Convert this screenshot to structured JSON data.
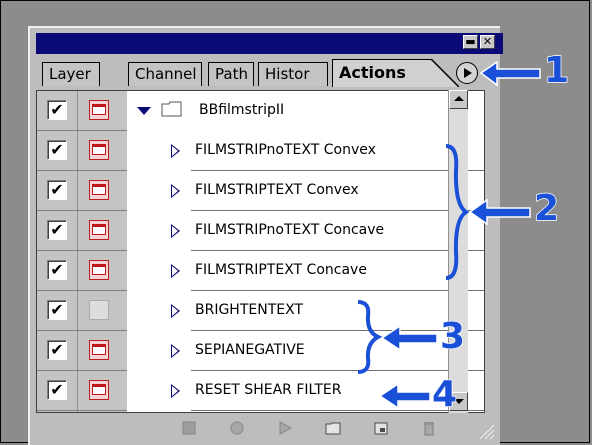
{
  "window": {
    "minimize_glyph": "▬",
    "close_glyph": "✕"
  },
  "tabs": [
    {
      "label": "Layer"
    },
    {
      "label": "Channel"
    },
    {
      "label": "Path"
    },
    {
      "label": "Histor"
    },
    {
      "label": "Actions",
      "active": true
    }
  ],
  "menu_button": {
    "icon": "play-circle-icon"
  },
  "action_set": {
    "name": "BBfilmstripII",
    "expanded": true,
    "icon": "folder-icon"
  },
  "actions": [
    {
      "label": "FILMSTRIPnoTEXT Convex",
      "checked": true,
      "dialog": true
    },
    {
      "label": "FILMSTRIPTEXT Convex",
      "checked": true,
      "dialog": true
    },
    {
      "label": "FILMSTRIPnoTEXT Concave",
      "checked": true,
      "dialog": true
    },
    {
      "label": "FILMSTRIPTEXT Concave",
      "checked": true,
      "dialog": true
    },
    {
      "label": "BRIGHTENTEXT",
      "checked": true,
      "dialog": false
    },
    {
      "label": "SEPIANEGATIVE",
      "checked": true,
      "dialog": true
    },
    {
      "label": "RESET SHEAR FILTER",
      "checked": true,
      "dialog": true
    }
  ],
  "check_glyph": "✔",
  "bottom_toolbar": [
    {
      "name": "stop-icon"
    },
    {
      "name": "record-icon"
    },
    {
      "name": "play-icon"
    },
    {
      "name": "new-set-icon"
    },
    {
      "name": "new-action-icon"
    },
    {
      "name": "trash-icon"
    }
  ],
  "annotations": [
    {
      "number": "1"
    },
    {
      "number": "2"
    },
    {
      "number": "3"
    },
    {
      "number": "4"
    }
  ],
  "colors": {
    "title_bar": "#0b0b78",
    "annotation": "#1a4fd8",
    "panel": "#bdbdbd",
    "background": "#8c8c8c"
  }
}
